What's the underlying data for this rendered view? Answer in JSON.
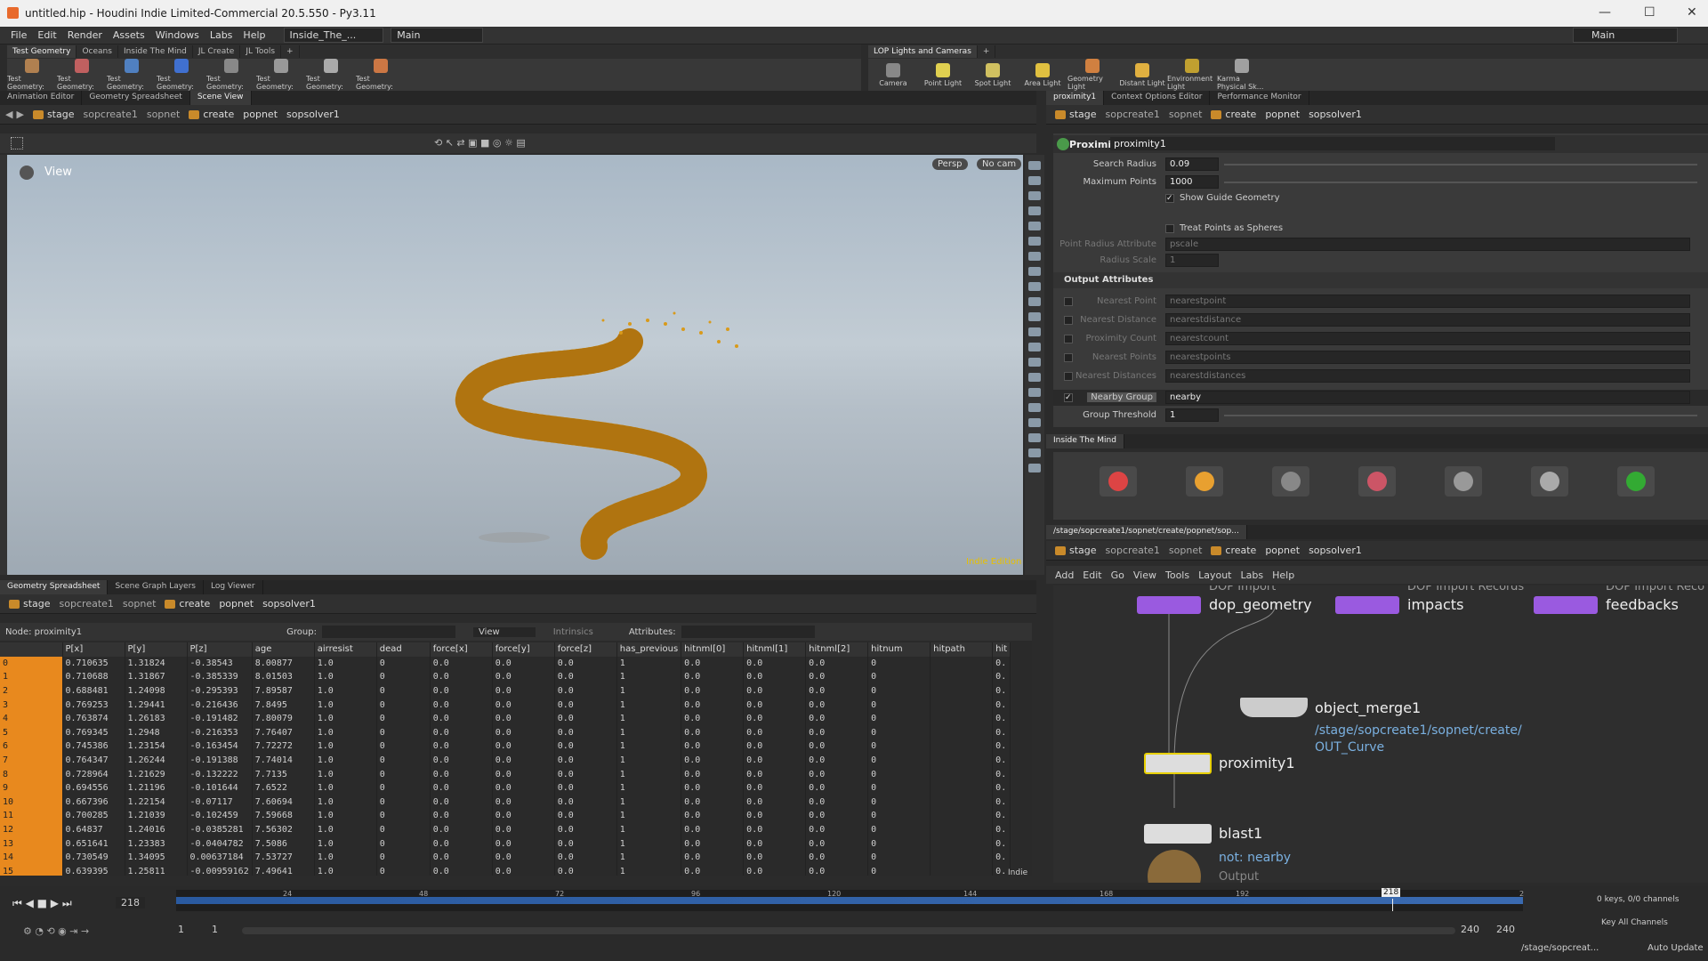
{
  "window": {
    "title": "untitled.hip - Houdini Indie Limited-Commercial 20.5.550 - Py3.11",
    "desktop_tab": "Inside_The_...",
    "desktop_main": "Main",
    "right_main": "Main"
  },
  "menu": [
    "File",
    "Edit",
    "Render",
    "Assets",
    "Windows",
    "Labs",
    "Help"
  ],
  "shelf_tabs_left": [
    "Test Geometry",
    "Oceans",
    "Inside The Mind",
    "JL Create",
    "JL Tools"
  ],
  "shelf_tools_left": [
    {
      "label": "Test Geometry:",
      "color": "#b08050"
    },
    {
      "label": "Test Geometry:",
      "color": "#c06060"
    },
    {
      "label": "Test Geometry:",
      "color": "#5080c0"
    },
    {
      "label": "Test Geometry:",
      "color": "#4070d0"
    },
    {
      "label": "Test Geometry:",
      "color": "#888888"
    },
    {
      "label": "Test Geometry:",
      "color": "#999999"
    },
    {
      "label": "Test Geometry:",
      "color": "#aaaaaa"
    },
    {
      "label": "Test Geometry:",
      "color": "#cc7744"
    }
  ],
  "shelf_tabs_right": [
    "LOP Lights and Cameras"
  ],
  "shelf_tools_right": [
    {
      "label": "Camera",
      "color": "#888888"
    },
    {
      "label": "Point Light",
      "color": "#e0d050"
    },
    {
      "label": "Spot Light",
      "color": "#d0c060"
    },
    {
      "label": "Area Light",
      "color": "#e0c040"
    },
    {
      "label": "Geometry Light",
      "color": "#d08040"
    },
    {
      "label": "Distant Light",
      "color": "#e0b040"
    },
    {
      "label": "Environment Light",
      "color": "#c0a030"
    },
    {
      "label": "Karma Physical Sk...",
      "color": "#a0a0a0"
    }
  ],
  "left_pane_tabs": [
    "Animation Editor",
    "Geometry Spreadsheet",
    "Scene View"
  ],
  "path": {
    "stage": "stage",
    "sopcreate": "sopcreate1",
    "sopnet": "sopnet",
    "create": "create",
    "popnet": "popnet",
    "sopsolver": "sopsolver1"
  },
  "viewport": {
    "label": "View",
    "persp": "Persp",
    "cam": "No cam",
    "watermark": "Indie Edition"
  },
  "params_tabs": [
    "proximity1",
    "Context Options Editor",
    "Performance Monitor"
  ],
  "params": {
    "node_type": "Proximity",
    "node_name": "proximity1",
    "search_radius_label": "Search Radius",
    "search_radius": "0.09",
    "max_points_label": "Maximum Points",
    "max_points": "1000",
    "show_guide": "Show Guide Geometry",
    "treat_spheres": "Treat Points as Spheres",
    "point_radius_label": "Point Radius Attribute",
    "point_radius": "pscale",
    "radius_scale_label": "Radius Scale",
    "radius_scale": "1",
    "output_header": "Output Attributes",
    "outputs": [
      {
        "label": "Nearest Point",
        "value": "nearestpoint"
      },
      {
        "label": "Nearest Distance",
        "value": "nearestdistance"
      },
      {
        "label": "Proximity Count",
        "value": "nearestcount"
      },
      {
        "label": "Nearest Points",
        "value": "nearestpoints"
      },
      {
        "label": "Nearest Distances",
        "value": "nearestdistances"
      }
    ],
    "nearby_group_label": "Nearby Group",
    "nearby_group": "nearby",
    "group_threshold_label": "Group Threshold",
    "group_threshold": "1"
  },
  "itm_tab": "Inside The Mind",
  "itm_icons": [
    {
      "name": "itm-tool-1",
      "color": "#d44"
    },
    {
      "name": "itm-tool-2",
      "color": "#e8a030"
    },
    {
      "name": "itm-tool-3",
      "color": "#888"
    },
    {
      "name": "itm-tool-4",
      "color": "#c56"
    },
    {
      "name": "itm-tool-5",
      "color": "#999"
    },
    {
      "name": "itm-tool-6",
      "color": "#aaa"
    },
    {
      "name": "itm-tool-7",
      "color": "#3a3"
    }
  ],
  "net_tab": "/stage/sopcreate1/sopnet/create/popnet/sop...",
  "net_menu": [
    "Add",
    "Edit",
    "Go",
    "View",
    "Tools",
    "Layout",
    "Labs",
    "Help"
  ],
  "nodes": {
    "dop_geometry_sub": "DOP Import",
    "dop_geometry": "dop_geometry",
    "impacts_sub": "DOP Import Records",
    "impacts": "impacts",
    "feedbacks_sub": "DOP Import Reco",
    "feedbacks": "feedbacks",
    "object_merge": "object_merge1",
    "object_merge_path": "/stage/sopcreate1/sopnet/create/ OUT_Curve",
    "proximity": "proximity1",
    "blast": "blast1",
    "blast_group": "not: nearby",
    "output": "Output"
  },
  "sheet_tabs": [
    "Geometry Spreadsheet",
    "Scene Graph Layers",
    "Log Viewer"
  ],
  "sheet": {
    "node_label": "Node: proximity1",
    "group_label": "Group:",
    "view_label": "View",
    "intrinsics": "Intrinsics",
    "attributes_label": "Attributes:",
    "columns": [
      "",
      "P[x]",
      "P[y]",
      "P[z]",
      "age",
      "airresist",
      "dead",
      "force[x]",
      "force[y]",
      "force[z]",
      "has_previous",
      "hitnml[0]",
      "hitnml[1]",
      "hitnml[2]",
      "hitnum",
      "hitpath",
      "hit"
    ],
    "rows": [
      [
        "0",
        "0.710635",
        "1.31824",
        "-0.38543",
        "8.00877",
        "1.0",
        "0",
        "0.0",
        "0.0",
        "0.0",
        "1",
        "0.0",
        "0.0",
        "0.0",
        "0",
        "",
        "0."
      ],
      [
        "1",
        "0.710688",
        "1.31867",
        "-0.385339",
        "8.01503",
        "1.0",
        "0",
        "0.0",
        "0.0",
        "0.0",
        "1",
        "0.0",
        "0.0",
        "0.0",
        "0",
        "",
        "0."
      ],
      [
        "2",
        "0.688481",
        "1.24098",
        "-0.295393",
        "7.89587",
        "1.0",
        "0",
        "0.0",
        "0.0",
        "0.0",
        "1",
        "0.0",
        "0.0",
        "0.0",
        "0",
        "",
        "0."
      ],
      [
        "3",
        "0.769253",
        "1.29441",
        "-0.216436",
        "7.8495",
        "1.0",
        "0",
        "0.0",
        "0.0",
        "0.0",
        "1",
        "0.0",
        "0.0",
        "0.0",
        "0",
        "",
        "0."
      ],
      [
        "4",
        "0.763874",
        "1.26183",
        "-0.191482",
        "7.80079",
        "1.0",
        "0",
        "0.0",
        "0.0",
        "0.0",
        "1",
        "0.0",
        "0.0",
        "0.0",
        "0",
        "",
        "0."
      ],
      [
        "5",
        "0.769345",
        "1.2948",
        "-0.216353",
        "7.76407",
        "1.0",
        "0",
        "0.0",
        "0.0",
        "0.0",
        "1",
        "0.0",
        "0.0",
        "0.0",
        "0",
        "",
        "0."
      ],
      [
        "6",
        "0.745386",
        "1.23154",
        "-0.163454",
        "7.72272",
        "1.0",
        "0",
        "0.0",
        "0.0",
        "0.0",
        "1",
        "0.0",
        "0.0",
        "0.0",
        "0",
        "",
        "0."
      ],
      [
        "7",
        "0.764347",
        "1.26244",
        "-0.191388",
        "7.74014",
        "1.0",
        "0",
        "0.0",
        "0.0",
        "0.0",
        "1",
        "0.0",
        "0.0",
        "0.0",
        "0",
        "",
        "0."
      ],
      [
        "8",
        "0.728964",
        "1.21629",
        "-0.132222",
        "7.7135",
        "1.0",
        "0",
        "0.0",
        "0.0",
        "0.0",
        "1",
        "0.0",
        "0.0",
        "0.0",
        "0",
        "",
        "0."
      ],
      [
        "9",
        "0.694556",
        "1.21196",
        "-0.101644",
        "7.6522",
        "1.0",
        "0",
        "0.0",
        "0.0",
        "0.0",
        "1",
        "0.0",
        "0.0",
        "0.0",
        "0",
        "",
        "0."
      ],
      [
        "10",
        "0.667396",
        "1.22154",
        "-0.07117",
        "7.60694",
        "1.0",
        "0",
        "0.0",
        "0.0",
        "0.0",
        "1",
        "0.0",
        "0.0",
        "0.0",
        "0",
        "",
        "0."
      ],
      [
        "11",
        "0.700285",
        "1.21039",
        "-0.102459",
        "7.59668",
        "1.0",
        "0",
        "0.0",
        "0.0",
        "0.0",
        "1",
        "0.0",
        "0.0",
        "0.0",
        "0",
        "",
        "0."
      ],
      [
        "12",
        "0.64837",
        "1.24016",
        "-0.0385281",
        "7.56302",
        "1.0",
        "0",
        "0.0",
        "0.0",
        "0.0",
        "1",
        "0.0",
        "0.0",
        "0.0",
        "0",
        "",
        "0."
      ],
      [
        "13",
        "0.651641",
        "1.23383",
        "-0.0404782",
        "7.5086",
        "1.0",
        "0",
        "0.0",
        "0.0",
        "0.0",
        "1",
        "0.0",
        "0.0",
        "0.0",
        "0",
        "",
        "0."
      ],
      [
        "14",
        "0.730549",
        "1.34095",
        "0.00637184",
        "7.53727",
        "1.0",
        "0",
        "0.0",
        "0.0",
        "0.0",
        "1",
        "0.0",
        "0.0",
        "0.0",
        "0",
        "",
        "0."
      ],
      [
        "15",
        "0.639395",
        "1.25811",
        "-0.00959162",
        "7.49641",
        "1.0",
        "0",
        "0.0",
        "0.0",
        "0.0",
        "1",
        "0.0",
        "0.0",
        "0.0",
        "0",
        "",
        "0."
      ]
    ],
    "footer": "Indie"
  },
  "timeline": {
    "frame": "218",
    "ticks": [
      "24",
      "48",
      "72",
      "96",
      "120",
      "144",
      "168",
      "192"
    ],
    "end_tick": "2",
    "range_start": "1",
    "range_start2": "1",
    "range_end": "240",
    "range_end2": "240",
    "keys": "0 keys, 0/0 channels",
    "key_all": "Key All Channels",
    "status_path": "/stage/sopcreat...",
    "auto_update": "Auto Update"
  }
}
